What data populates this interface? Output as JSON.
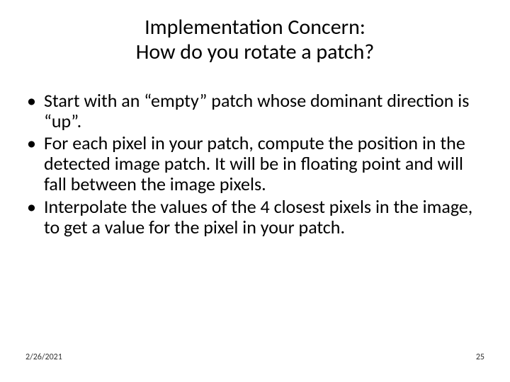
{
  "title": {
    "line1": "Implementation Concern:",
    "line2": "How do you rotate a patch?"
  },
  "bullets": [
    "Start with an “empty” patch whose dominant direction is “up”.",
    "For each pixel in your patch, compute the position in the detected image patch. It will be in floating point and will fall between the image pixels.",
    "Interpolate the values of the 4 closest pixels in the image, to get a value for the pixel in your patch."
  ],
  "footer": {
    "date": "2/26/2021",
    "page": "25"
  }
}
